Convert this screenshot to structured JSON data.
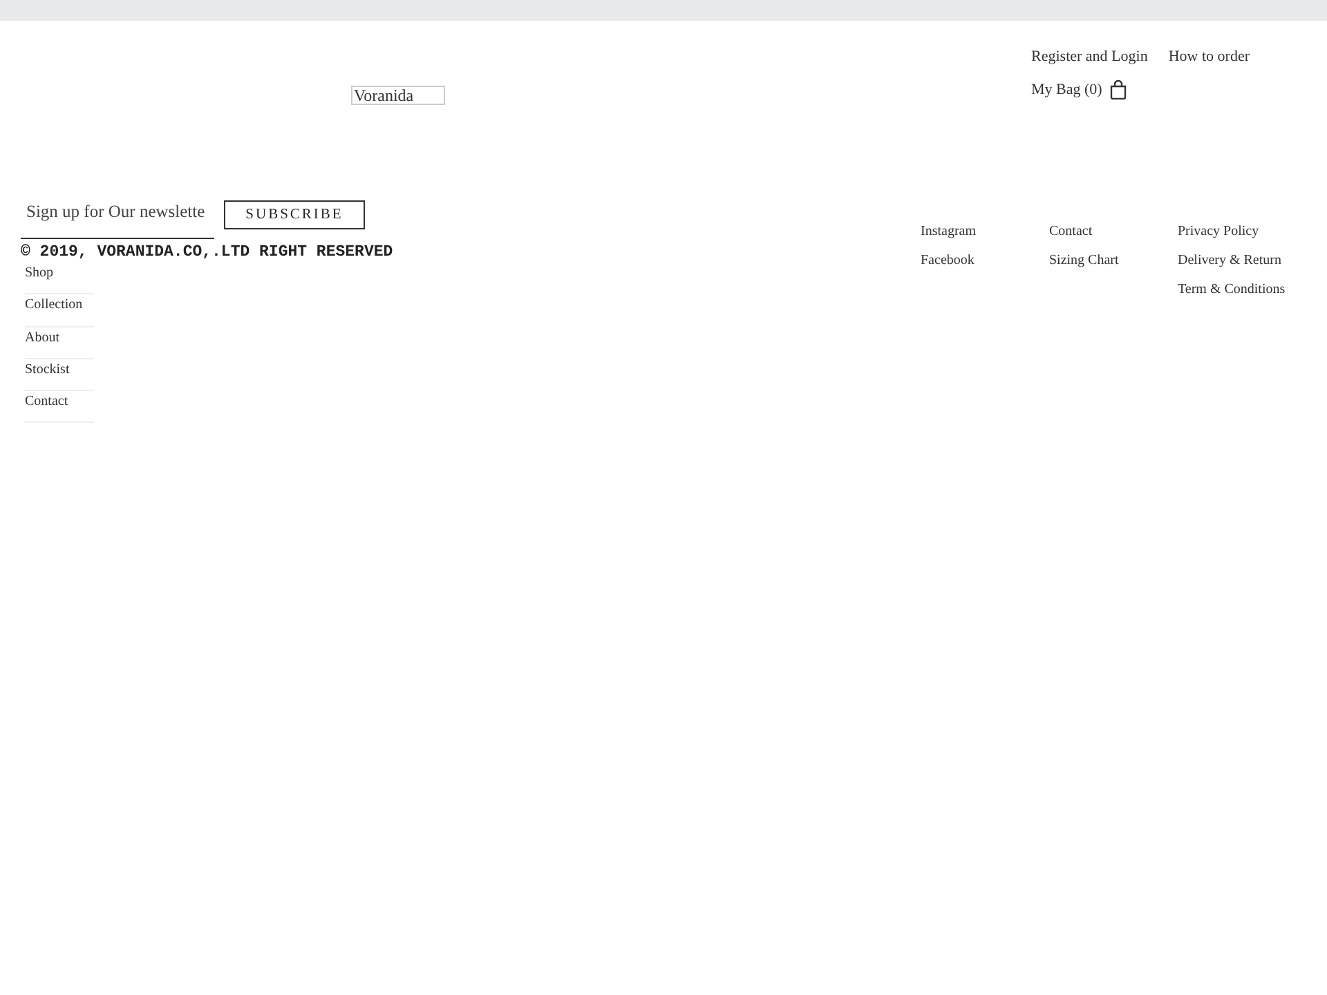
{
  "header": {
    "logo": "Voranida",
    "links": [
      "Register and Login",
      "How to order"
    ],
    "bag_label": "My Bag (0)"
  },
  "newsletter": {
    "placeholder": "Sign up for Our newslette",
    "button": "SUBSCRIBE"
  },
  "copyright": "© 2019, VORANIDA.CO,.LTD RIGHT RESERVED",
  "nav": [
    "Shop",
    "Collection",
    "About",
    "Stockist",
    "Contact"
  ],
  "footer_columns": [
    {
      "links": [
        "Instagram",
        "Facebook"
      ]
    },
    {
      "links": [
        "Contact",
        "Sizing Chart"
      ]
    },
    {
      "links": [
        "Privacy Policy",
        "Delivery & Return",
        "Term & Conditions"
      ]
    }
  ]
}
